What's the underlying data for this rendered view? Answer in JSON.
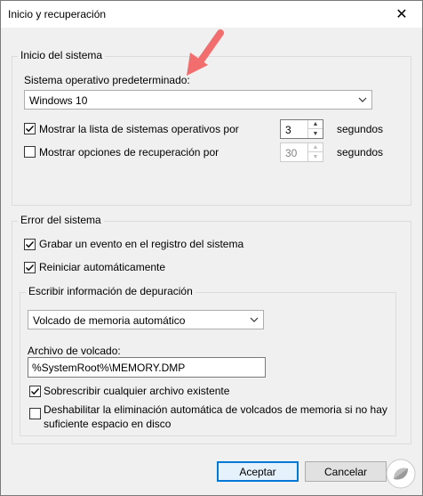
{
  "window": {
    "title": "Inicio y recuperación"
  },
  "startup": {
    "group_label": "Inicio del sistema",
    "default_os_label": "Sistema operativo predeterminado:",
    "default_os_value": "Windows 10",
    "show_os_list_label": "Mostrar la lista de sistemas operativos por",
    "show_os_list_checked": true,
    "show_os_list_value": "3",
    "show_recovery_label": "Mostrar opciones de recuperación por",
    "show_recovery_checked": false,
    "show_recovery_value": "30",
    "seconds_label": "segundos"
  },
  "failure": {
    "group_label": "Error del sistema",
    "log_event_label": "Grabar un evento en el registro del sistema",
    "log_event_checked": true,
    "auto_restart_label": "Reiniciar automáticamente",
    "auto_restart_checked": true,
    "debug": {
      "group_label": "Escribir información de depuración",
      "dump_type_value": "Volcado de memoria automático",
      "dump_file_label": "Archivo de volcado:",
      "dump_file_value": "%SystemRoot%\\MEMORY.DMP",
      "overwrite_label": "Sobrescribir cualquier archivo existente",
      "overwrite_checked": true,
      "disable_auto_delete_line1": "Deshabilitar la eliminación automática de volcados de memoria si no hay",
      "disable_auto_delete_line2": "suficiente espacio en disco",
      "disable_auto_delete_checked": false
    }
  },
  "buttons": {
    "ok": "Aceptar",
    "cancel": "Cancelar"
  },
  "colors": {
    "annotation_arrow": "#f26d6d",
    "default_button_border": "#0078d7"
  }
}
